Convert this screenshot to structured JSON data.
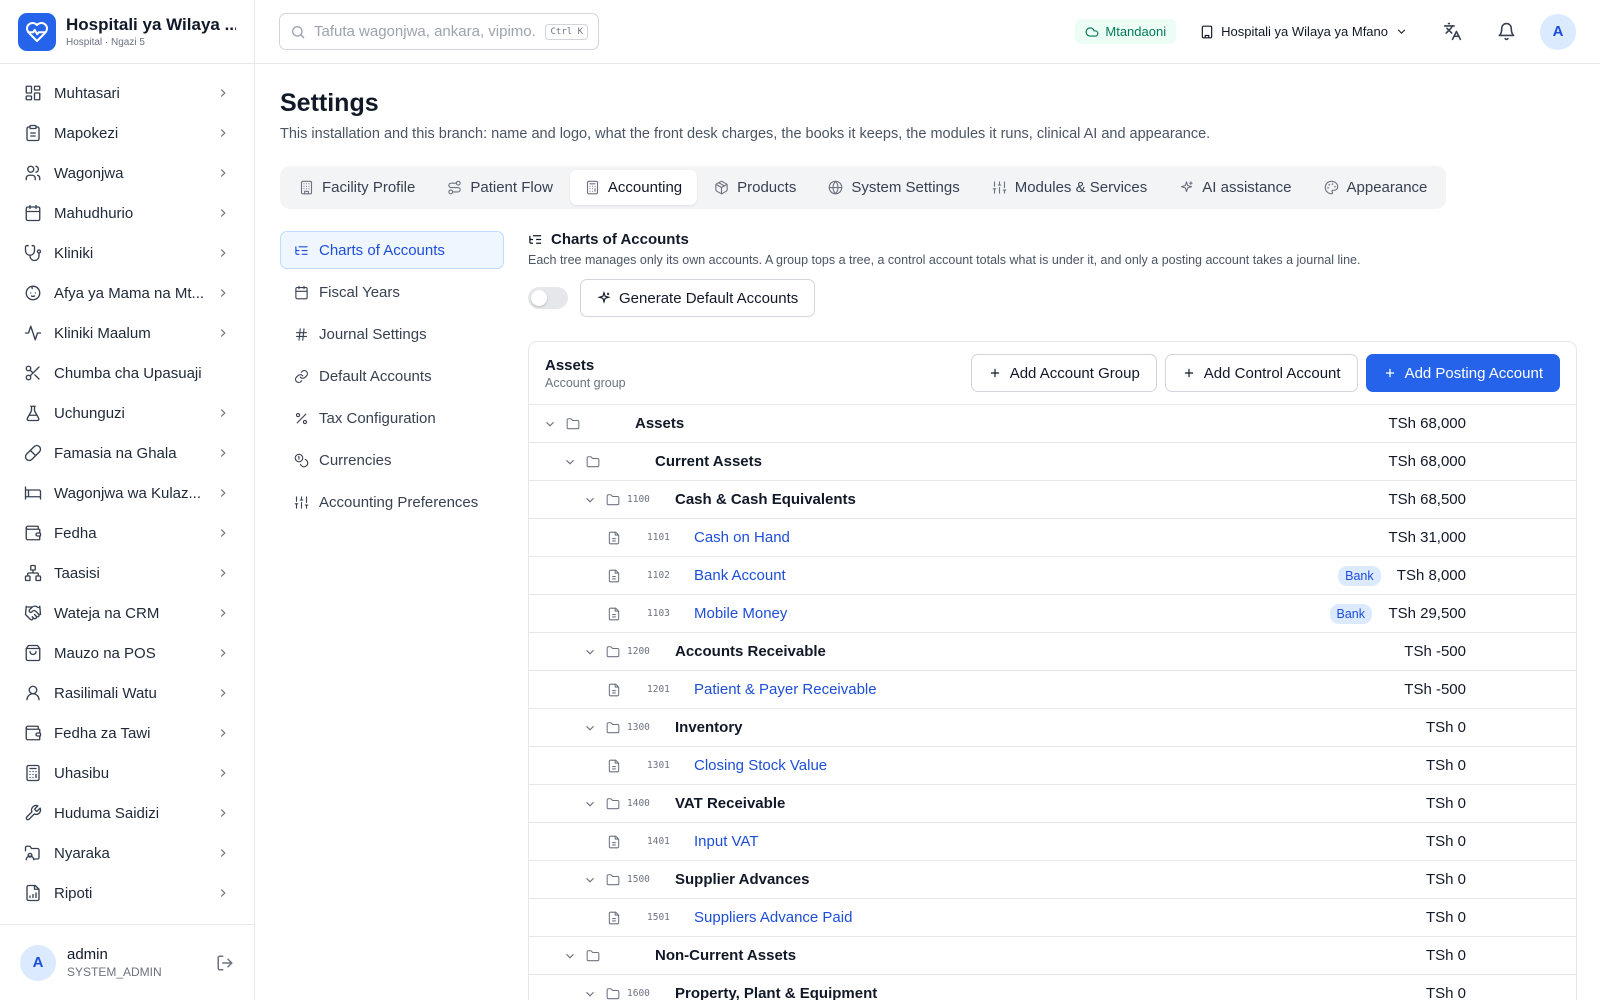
{
  "app": {
    "name": "Hospitali ya Wilaya ...",
    "subtitle": "Hospital · Ngazi 5",
    "accent": "#2563eb"
  },
  "sidebar": {
    "items": [
      {
        "label": "Muhtasari",
        "icon": "dashboard-icon",
        "chevron": true
      },
      {
        "label": "Mapokezi",
        "icon": "clipboard-icon",
        "chevron": true
      },
      {
        "label": "Wagonjwa",
        "icon": "users-icon",
        "chevron": true
      },
      {
        "label": "Mahudhurio",
        "icon": "calendar-icon",
        "chevron": true
      },
      {
        "label": "Kliniki",
        "icon": "stethoscope-icon",
        "chevron": true
      },
      {
        "label": "Afya ya Mama na Mt...",
        "icon": "baby-icon",
        "chevron": true
      },
      {
        "label": "Kliniki Maalum",
        "icon": "activity-icon",
        "chevron": true
      },
      {
        "label": "Chumba cha Upasuaji",
        "icon": "scissors-icon",
        "chevron": false
      },
      {
        "label": "Uchunguzi",
        "icon": "flask-icon",
        "chevron": true
      },
      {
        "label": "Famasia na Ghala",
        "icon": "pill-icon",
        "chevron": true
      },
      {
        "label": "Wagonjwa wa Kulaz...",
        "icon": "bed-icon",
        "chevron": true
      },
      {
        "label": "Fedha",
        "icon": "wallet-icon",
        "chevron": true
      },
      {
        "label": "Taasisi",
        "icon": "network-icon",
        "chevron": true
      },
      {
        "label": "Wateja na CRM",
        "icon": "handshake-icon",
        "chevron": true
      },
      {
        "label": "Mauzo na POS",
        "icon": "shopping-bag-icon",
        "chevron": true
      },
      {
        "label": "Rasilimali Watu",
        "icon": "user-icon",
        "chevron": true
      },
      {
        "label": "Fedha za Tawi",
        "icon": "wallet-icon",
        "chevron": true
      },
      {
        "label": "Uhasibu",
        "icon": "calculator-icon",
        "chevron": true
      },
      {
        "label": "Huduma Saidizi",
        "icon": "wrench-icon",
        "chevron": true
      },
      {
        "label": "Nyaraka",
        "icon": "folder-user-icon",
        "chevron": true
      },
      {
        "label": "Ripoti",
        "icon": "file-chart-icon",
        "chevron": true
      }
    ]
  },
  "user": {
    "initial": "A",
    "name": "admin",
    "role": "SYSTEM_ADMIN"
  },
  "header": {
    "search_placeholder": "Tafuta wagonjwa, ankara, vipimo...",
    "search_shortcut": "Ctrl K",
    "status": "Mtandaoni",
    "branch": "Hospitali ya Wilaya ya Mfano",
    "avatar_initial": "A"
  },
  "page": {
    "title": "Settings",
    "description": "This installation and this branch: name and logo, what the front desk charges, the books it keeps, the modules it runs, clinical AI and appearance."
  },
  "tabs": [
    {
      "label": "Facility Profile",
      "icon": "building-icon",
      "active": false
    },
    {
      "label": "Patient Flow",
      "icon": "route-icon",
      "active": false
    },
    {
      "label": "Accounting",
      "icon": "calculator-icon",
      "active": true
    },
    {
      "label": "Products",
      "icon": "package-icon",
      "active": false
    },
    {
      "label": "System Settings",
      "icon": "globe-icon",
      "active": false
    },
    {
      "label": "Modules & Services",
      "icon": "sliders-icon",
      "active": false
    },
    {
      "label": "AI assistance",
      "icon": "sparkles-icon",
      "active": false
    },
    {
      "label": "Appearance",
      "icon": "palette-icon",
      "active": false
    }
  ],
  "subnav": [
    {
      "label": "Charts of Accounts",
      "icon": "list-tree-icon",
      "active": true
    },
    {
      "label": "Fiscal Years",
      "icon": "calendar-icon",
      "active": false
    },
    {
      "label": "Journal Settings",
      "icon": "hash-icon",
      "active": false
    },
    {
      "label": "Default Accounts",
      "icon": "link-icon",
      "active": false
    },
    {
      "label": "Tax Configuration",
      "icon": "percent-icon",
      "active": false
    },
    {
      "label": "Currencies",
      "icon": "coins-icon",
      "active": false
    },
    {
      "label": "Accounting Preferences",
      "icon": "sliders-icon",
      "active": false
    }
  ],
  "panel": {
    "title": "Charts of Accounts",
    "description": "Each tree manages only its own accounts. A group tops a tree, a control account totals what is under it, and only a posting account takes a journal line.",
    "generate_label": "Generate Default Accounts",
    "toggle_on": false
  },
  "card": {
    "title": "Assets",
    "subtitle": "Account group",
    "add_group": "Add Account Group",
    "add_control": "Add Control Account",
    "add_posting": "Add Posting Account"
  },
  "accounts": [
    {
      "level": 0,
      "kind": "group",
      "code": "",
      "name": "Assets",
      "balance": "TSh 68,000",
      "expanded": true
    },
    {
      "level": 1,
      "kind": "group",
      "code": "",
      "name": "Current Assets",
      "balance": "TSh 68,000",
      "expanded": true
    },
    {
      "level": 2,
      "kind": "control",
      "code": "1100",
      "name": "Cash & Cash Equivalents",
      "balance": "TSh 68,500",
      "expanded": true
    },
    {
      "level": 3,
      "kind": "posting",
      "code": "1101",
      "name": "Cash on Hand",
      "balance": "TSh 31,000"
    },
    {
      "level": 3,
      "kind": "posting",
      "code": "1102",
      "name": "Bank Account",
      "balance": "TSh 8,000",
      "badge": "Bank"
    },
    {
      "level": 3,
      "kind": "posting",
      "code": "1103",
      "name": "Mobile Money",
      "balance": "TSh 29,500",
      "badge": "Bank"
    },
    {
      "level": 2,
      "kind": "control",
      "code": "1200",
      "name": "Accounts Receivable",
      "balance": "TSh -500",
      "expanded": true
    },
    {
      "level": 3,
      "kind": "posting",
      "code": "1201",
      "name": "Patient & Payer Receivable",
      "balance": "TSh -500"
    },
    {
      "level": 2,
      "kind": "control",
      "code": "1300",
      "name": "Inventory",
      "balance": "TSh 0",
      "expanded": true
    },
    {
      "level": 3,
      "kind": "posting",
      "code": "1301",
      "name": "Closing Stock Value",
      "balance": "TSh 0"
    },
    {
      "level": 2,
      "kind": "control",
      "code": "1400",
      "name": "VAT Receivable",
      "balance": "TSh 0",
      "expanded": true
    },
    {
      "level": 3,
      "kind": "posting",
      "code": "1401",
      "name": "Input VAT",
      "balance": "TSh 0"
    },
    {
      "level": 2,
      "kind": "control",
      "code": "1500",
      "name": "Supplier Advances",
      "balance": "TSh 0",
      "expanded": true
    },
    {
      "level": 3,
      "kind": "posting",
      "code": "1501",
      "name": "Suppliers Advance Paid",
      "balance": "TSh 0"
    },
    {
      "level": 1,
      "kind": "group",
      "code": "",
      "name": "Non-Current Assets",
      "balance": "TSh 0",
      "expanded": true
    },
    {
      "level": 2,
      "kind": "control",
      "code": "1600",
      "name": "Property, Plant & Equipment",
      "balance": "TSh 0",
      "expanded": true
    }
  ]
}
